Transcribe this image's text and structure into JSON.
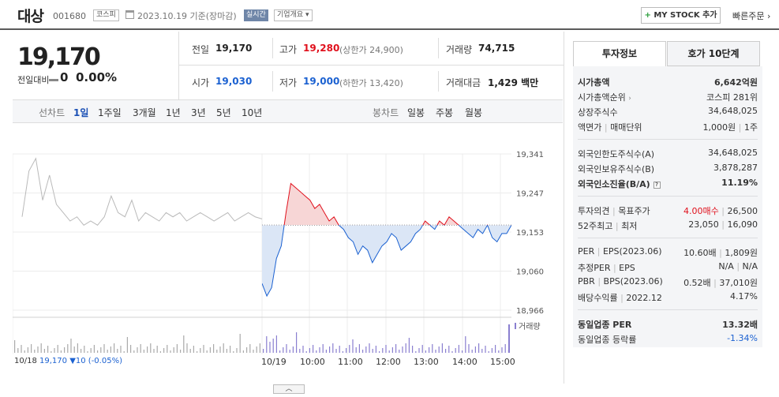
{
  "header": {
    "name": "대상",
    "code": "001680",
    "market": "코스피",
    "date_text": "2023.10.19 기준(장마감)",
    "realtime": "실시간",
    "company_overview": "기업개요 ▾",
    "mystock": "MY STOCK 추가",
    "mystock_plus": "+",
    "quick_order": "빠른주문 ›"
  },
  "price": {
    "current": "19,170",
    "change_label": "전일대비",
    "change": "0",
    "change_rate": "0.00%"
  },
  "quotes": {
    "prev_label": "전일",
    "prev": "19,170",
    "high_label": "고가",
    "high": "19,280",
    "upper_limit": "(상한가 24,900)",
    "volume_label": "거래량",
    "volume": "74,715",
    "open_label": "시가",
    "open": "19,030",
    "low_label": "저가",
    "low": "19,000",
    "lower_limit": "(하한가 13,420)",
    "amount_label": "거래대금",
    "amount": "1,429 백만"
  },
  "period_bar": {
    "line_label": "선차트",
    "periods": [
      "1일",
      "1주일",
      "3개월",
      "1년",
      "3년",
      "5년",
      "10년"
    ],
    "selected": "1일",
    "candle_label": "봉차트",
    "candles": [
      "일봉",
      "주봉",
      "월봉"
    ]
  },
  "chart_data": {
    "type": "line",
    "title": "",
    "y_ticks": [
      "19,341",
      "19,247",
      "19,153",
      "19,060",
      "18,966"
    ],
    "ylim": [
      18966,
      19341
    ],
    "reference_price": 19170,
    "x_ticks": [
      "10/18",
      "10/19",
      "10:00",
      "11:00",
      "12:00",
      "13:00",
      "14:00",
      "15:00"
    ],
    "volume_legend": "거래량",
    "previous_day": {
      "name": "10/18",
      "values": [
        19190,
        19300,
        19330,
        19230,
        19290,
        19220,
        19200,
        19180,
        19190,
        19170,
        19180,
        19170,
        19190,
        19240,
        19200,
        19190,
        19230,
        19180,
        19200,
        19190,
        19180,
        19200,
        19190,
        19200,
        19180,
        19190,
        19200,
        19190,
        19180,
        19190,
        19200,
        19180,
        19190,
        19200,
        19190,
        19185
      ]
    },
    "today": {
      "name": "10/19",
      "values": [
        19030,
        19000,
        19020,
        19090,
        19120,
        19200,
        19270,
        19260,
        19250,
        19240,
        19230,
        19210,
        19220,
        19200,
        19180,
        19190,
        19170,
        19160,
        19140,
        19130,
        19100,
        19120,
        19110,
        19080,
        19100,
        19120,
        19130,
        19150,
        19140,
        19110,
        19120,
        19130,
        19150,
        19160,
        19180,
        19170,
        19160,
        19180,
        19170,
        19190,
        19180,
        19170,
        19160,
        19150,
        19140,
        19160,
        19150,
        19170,
        19140,
        19130,
        19150,
        19150,
        19170
      ]
    },
    "bottom_legend": {
      "date": "10/18",
      "price": "19,170",
      "change": "▼10 (-0.05%)"
    }
  },
  "info_panel": {
    "tabs": [
      "투자정보",
      "호가 10단계"
    ],
    "selected_tab": "투자정보",
    "group1": [
      {
        "label": "시가총액",
        "value": "6,642억원",
        "bold": true
      },
      {
        "label": "시가총액순위",
        "value": "코스피 281위",
        "arrow": true
      },
      {
        "label": "상장주식수",
        "value": "34,648,025"
      },
      {
        "label": "액면가",
        "label2": "매매단위",
        "value": "1,000원",
        "value2": "1주"
      }
    ],
    "group2": [
      {
        "label": "외국인한도주식수(A)",
        "value": "34,648,025"
      },
      {
        "label": "외국인보유주식수(B)",
        "value": "3,878,287"
      },
      {
        "label": "외국인소진율(B/A)",
        "value": "11.19%",
        "bold": true,
        "help": true
      }
    ],
    "group3": [
      {
        "label": "투자의견",
        "label2": "목표주가",
        "value": "4.00매수",
        "value2": "26,500"
      },
      {
        "label": "52주최고",
        "label2": "최저",
        "value": "23,050",
        "value2": "16,090"
      }
    ],
    "group4": [
      {
        "label": "PER",
        "label2": "EPS(2023.06)",
        "value": "10.60배",
        "value2": "1,809원"
      },
      {
        "label": "추정PER",
        "label2": "EPS",
        "value": "N/A",
        "value2": "N/A"
      },
      {
        "label": "PBR",
        "label2": "BPS(2023.06)",
        "value": "0.52배",
        "value2": "37,010원"
      },
      {
        "label": "배당수익률",
        "label2": "2022.12",
        "value": "4.17%"
      }
    ],
    "group5": [
      {
        "label": "동일업종 PER",
        "value": "13.32배",
        "bold": true
      },
      {
        "label": "동일업종 등락률",
        "value": "-1.34%"
      }
    ],
    "help_glyph": "?"
  },
  "colors": {
    "up": "#e0101c",
    "down": "#1b61d1",
    "prev_line": "#b9b9b9",
    "volume": "#8a7fd0"
  }
}
